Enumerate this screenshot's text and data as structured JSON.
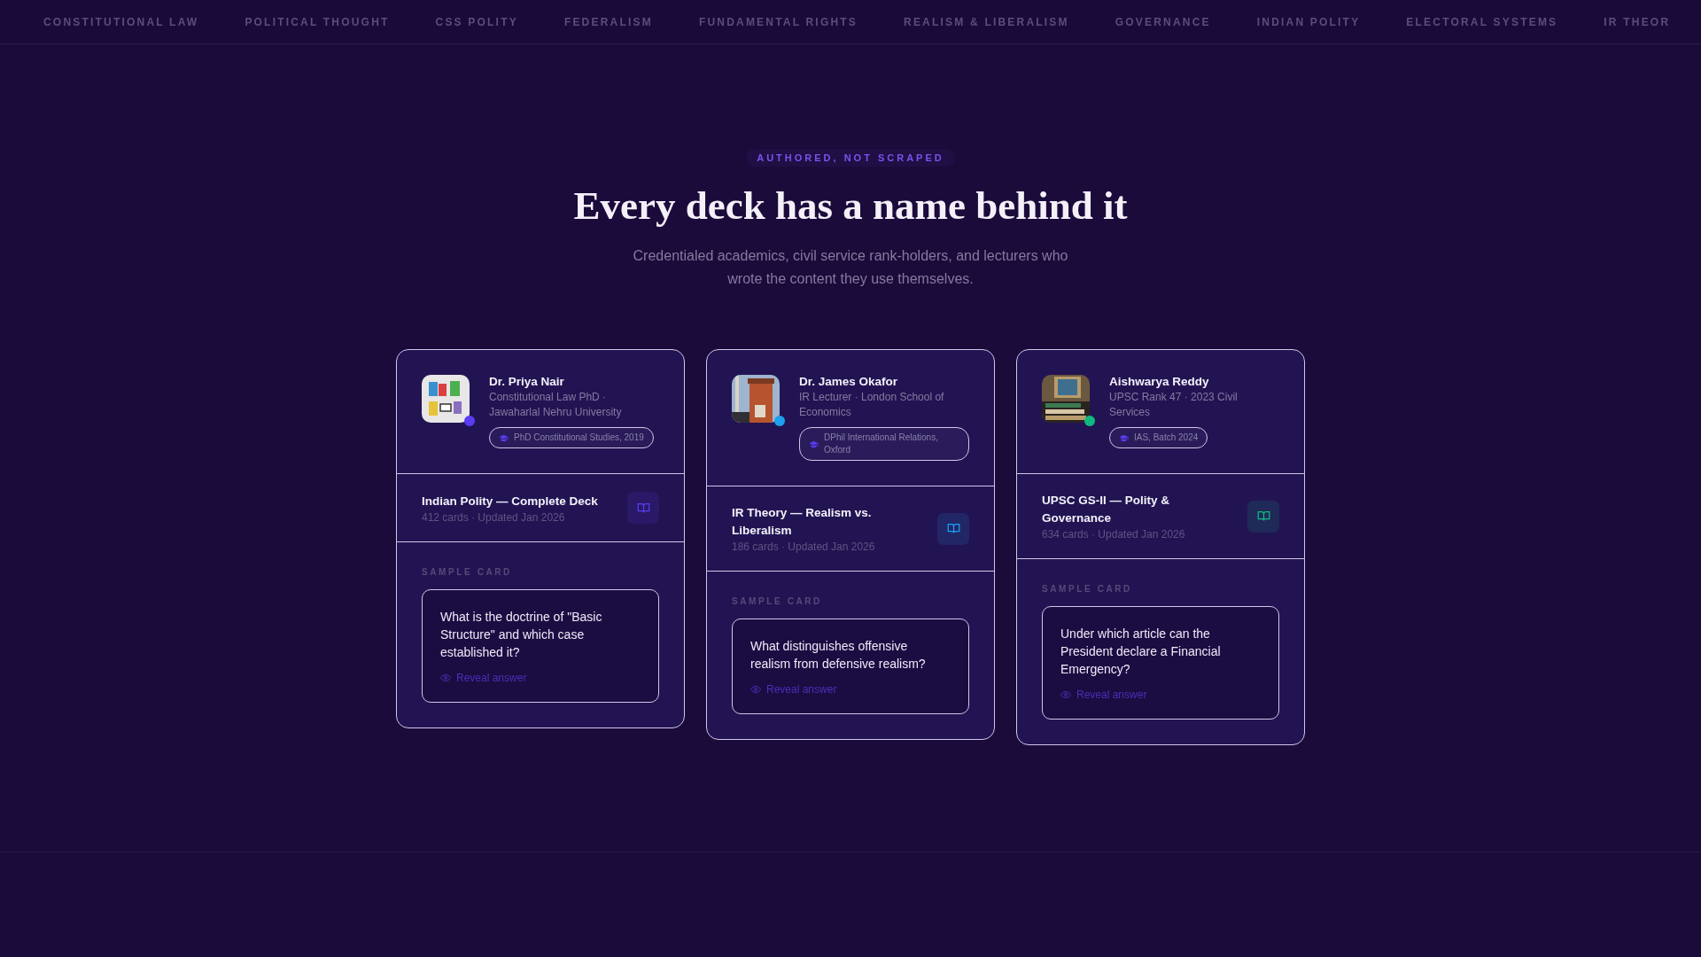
{
  "topics": [
    "CONSTITUTIONAL LAW",
    "POLITICAL THOUGHT",
    "CSS POLITY",
    "FEDERALISM",
    "FUNDAMENTAL RIGHTS",
    "REALISM & LIBERALISM",
    "GOVERNANCE",
    "INDIAN POLITY",
    "ELECTORAL SYSTEMS",
    "IR THEOR"
  ],
  "eyebrow": "AUTHORED, NOT SCRAPED",
  "heading": "Every deck has a name behind it",
  "subtitle": "Credentialed academics, civil service rank-holders, and lecturers who wrote the content they use themselves.",
  "authors": [
    {
      "name": "Dr. Priya Nair",
      "role": "Constitutional Law PhD · Jawaharlal Nehru University",
      "credential": "PhD Constitutional Studies, 2019",
      "color": "#5b3cf0",
      "deck": {
        "title": "Indian Polity — Complete Deck",
        "meta": "412 cards · Updated Jan 2026"
      },
      "sample": {
        "label": "SAMPLE CARD",
        "question": "What is the doctrine of \"Basic Structure\" and which case established it?",
        "action": "Reveal answer"
      }
    },
    {
      "name": "Dr. James Okafor",
      "role": "IR Lecturer · London School of Economics",
      "credential": "DPhil International Relations, Oxford",
      "color": "#1ea0f0",
      "deck": {
        "title": "IR Theory — Realism vs. Liberalism",
        "meta": "186 cards · Updated Jan 2026"
      },
      "sample": {
        "label": "SAMPLE CARD",
        "question": "What distinguishes offensive realism from defensive realism?",
        "action": "Reveal answer"
      }
    },
    {
      "name": "Aishwarya Reddy",
      "role": "UPSC Rank 47 · 2023 Civil Services",
      "credential": "IAS, Batch 2024",
      "color": "#10b981",
      "deck": {
        "title": "UPSC GS-II — Polity & Governance",
        "meta": "634 cards · Updated Jan 2026"
      },
      "sample": {
        "label": "SAMPLE CARD",
        "question": "Under which article can the President declare a Financial Emergency?",
        "action": "Reveal answer"
      }
    }
  ]
}
